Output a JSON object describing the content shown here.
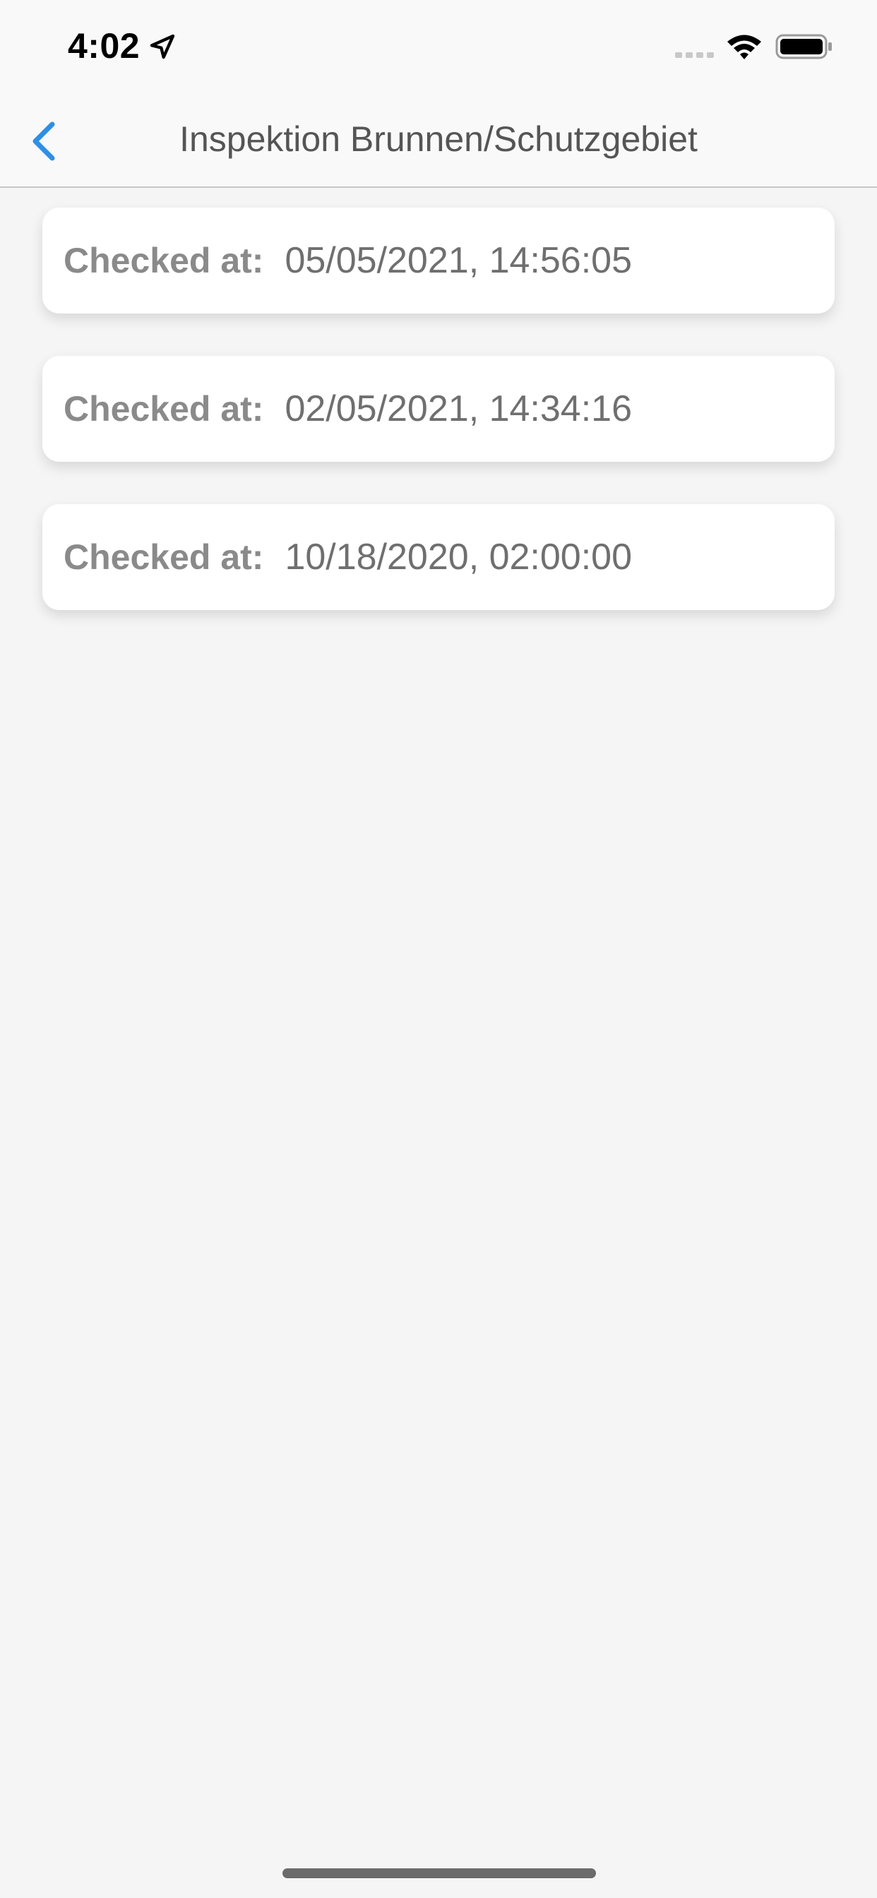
{
  "status_bar": {
    "time": "4:02",
    "icons": [
      "location-arrow-icon",
      "cellular-signal-icon",
      "wifi-icon",
      "battery-icon"
    ]
  },
  "nav": {
    "title": "Inspektion Brunnen/Schutzgebiet",
    "back_icon": "chevron-left-icon",
    "accent_color": "#2f8fe6"
  },
  "inspections": [
    {
      "label": "Checked at:",
      "value": "05/05/2021, 14:56:05"
    },
    {
      "label": "Checked at:",
      "value": "02/05/2021, 14:34:16"
    },
    {
      "label": "Checked at:",
      "value": "10/18/2020, 02:00:00"
    }
  ]
}
